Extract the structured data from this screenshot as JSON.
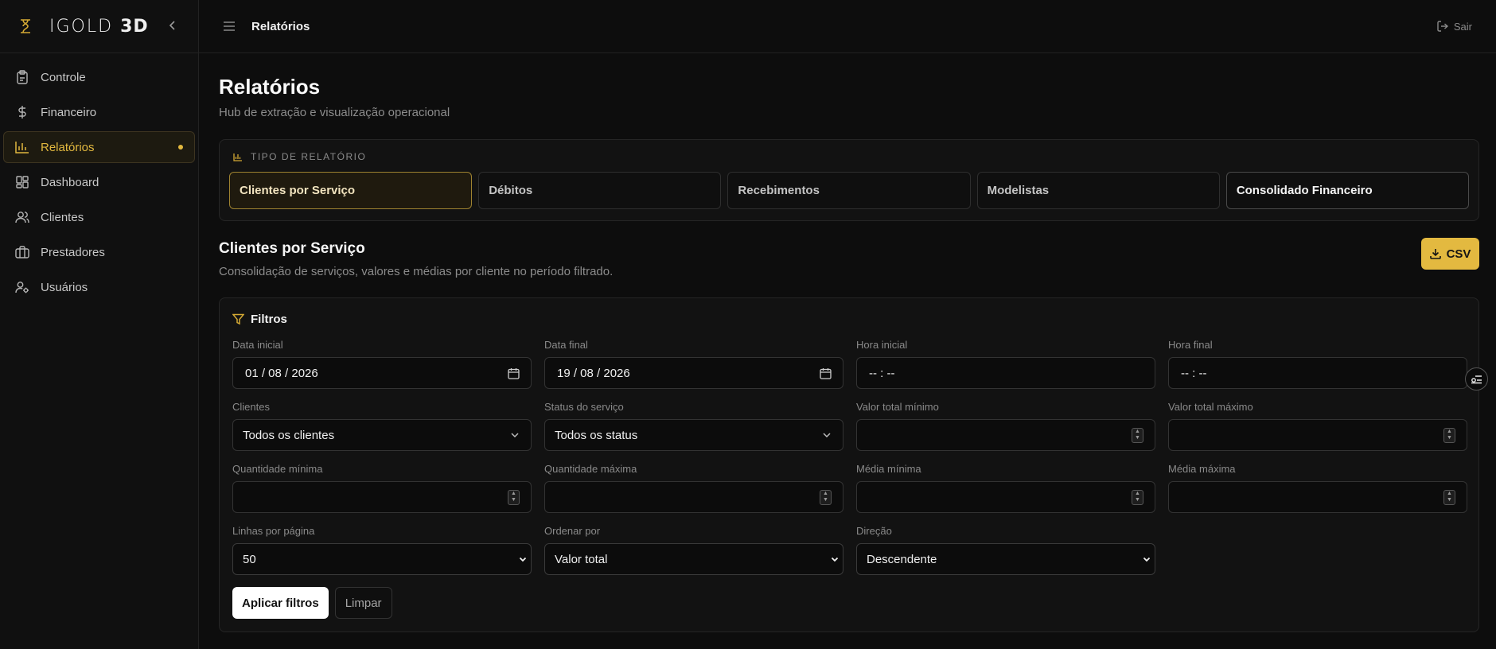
{
  "brand": {
    "name_light": "IGOLD",
    "name_bold": "3D",
    "accent": "#e3b940"
  },
  "sidebar": {
    "items": [
      {
        "label": "Controle",
        "icon": "clipboard-icon"
      },
      {
        "label": "Financeiro",
        "icon": "dollar-icon"
      },
      {
        "label": "Relatórios",
        "icon": "bar-chart-icon",
        "active": true
      },
      {
        "label": "Dashboard",
        "icon": "dashboard-grid-icon"
      },
      {
        "label": "Clientes",
        "icon": "users-icon"
      },
      {
        "label": "Prestadores",
        "icon": "briefcase-icon"
      },
      {
        "label": "Usuários",
        "icon": "user-cog-icon"
      }
    ]
  },
  "topbar": {
    "breadcrumb": "Relatórios",
    "logout_label": "Sair"
  },
  "page": {
    "title": "Relatórios",
    "subtitle": "Hub de extração e visualização operacional"
  },
  "report_type": {
    "heading": "TIPO DE RELATÓRIO",
    "tabs": [
      {
        "label": "Clientes por Serviço",
        "selected": true
      },
      {
        "label": "Débitos"
      },
      {
        "label": "Recebimentos"
      },
      {
        "label": "Modelistas"
      },
      {
        "label": "Consolidado Financeiro"
      }
    ]
  },
  "section": {
    "title": "Clientes por Serviço",
    "subtitle": "Consolidação de serviços, valores e médias por cliente no período filtrado.",
    "csv_label": "CSV"
  },
  "filters": {
    "heading": "Filtros",
    "date_start": {
      "label": "Data inicial",
      "value": "01 / 08 / 2026"
    },
    "date_end": {
      "label": "Data final",
      "value": "19 / 08 / 2026"
    },
    "time_start": {
      "label": "Hora inicial",
      "value": "-- : --"
    },
    "time_end": {
      "label": "Hora final",
      "value": "-- : --"
    },
    "clients": {
      "label": "Clientes",
      "value": "Todos os clientes"
    },
    "status": {
      "label": "Status do serviço",
      "value": "Todos os status"
    },
    "total_min": {
      "label": "Valor total mínimo",
      "value": ""
    },
    "total_max": {
      "label": "Valor total máximo",
      "value": ""
    },
    "qty_min": {
      "label": "Quantidade mínima",
      "value": ""
    },
    "qty_max": {
      "label": "Quantidade máxima",
      "value": ""
    },
    "avg_min": {
      "label": "Média mínima",
      "value": ""
    },
    "avg_max": {
      "label": "Média máxima",
      "value": ""
    },
    "rows_per_page": {
      "label": "Linhas por página",
      "value": "50"
    },
    "order_by": {
      "label": "Ordenar por",
      "value": "Valor total"
    },
    "direction": {
      "label": "Direção",
      "value": "Descendente"
    },
    "apply_label": "Aplicar filtros",
    "clear_label": "Limpar"
  }
}
